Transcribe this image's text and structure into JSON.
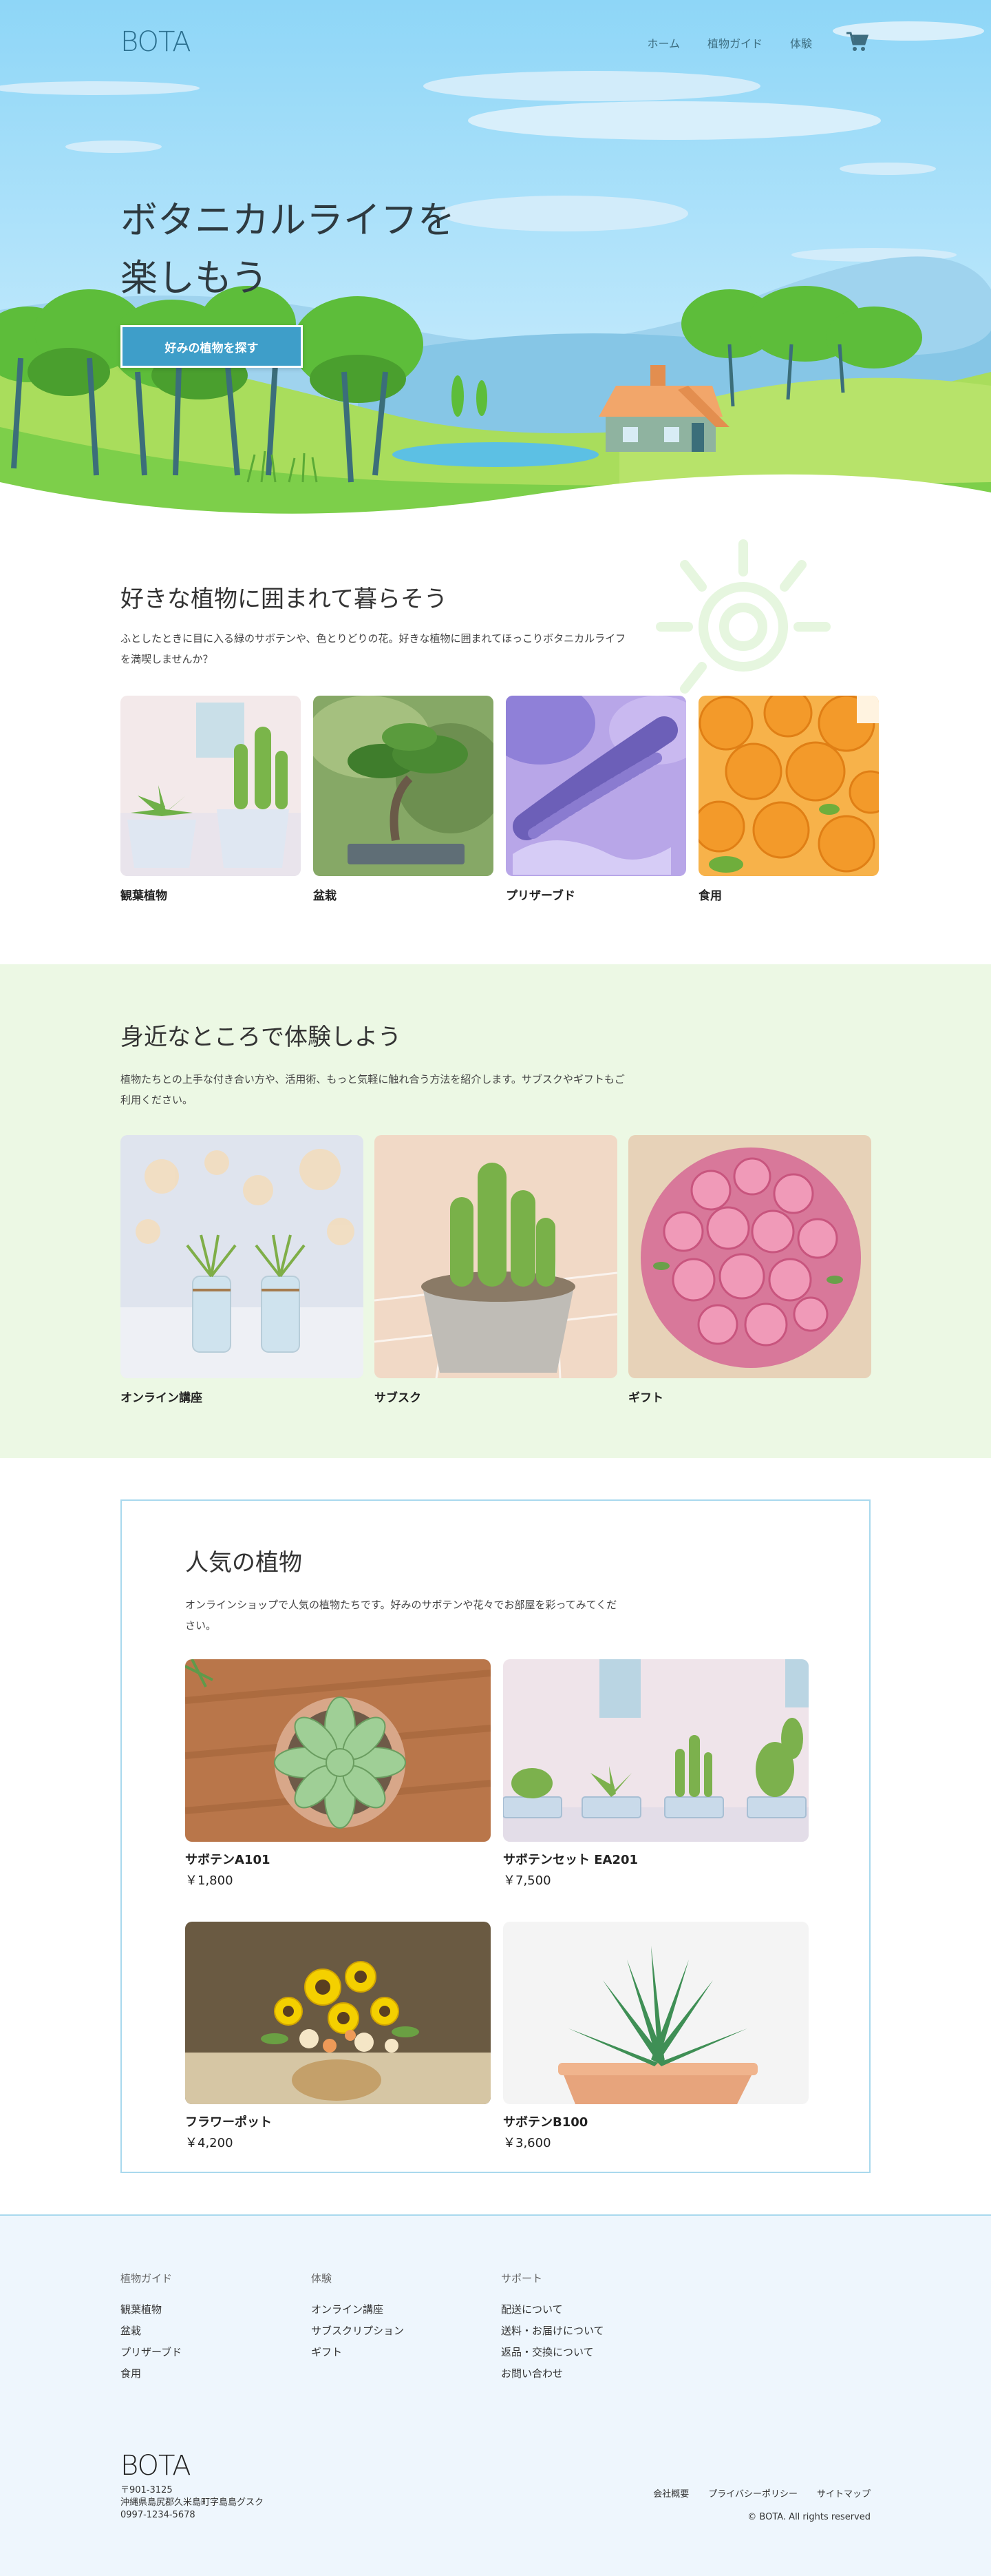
{
  "header": {
    "logo": "BOTA",
    "nav": [
      "ホーム",
      "植物ガイド",
      "体験"
    ],
    "cart_icon": "cart-icon"
  },
  "hero": {
    "title_line1": "ボタニカルライフを",
    "title_line2": "楽しもう",
    "cta": "好みの植物を探す"
  },
  "section_plants": {
    "title": "好きな植物に囲まれて暮らそう",
    "description": "ふとしたときに目に入る緑のサボテンや、色とりどりの花。好きな植物に囲まれてほっこりボタニカルライフを満喫しませんか？",
    "items": [
      {
        "label": "観葉植物"
      },
      {
        "label": "盆栽"
      },
      {
        "label": "プリザーブド"
      },
      {
        "label": "食用"
      }
    ]
  },
  "section_experience": {
    "title": "身近なところで体験しよう",
    "description": "植物たちとの上手な付き合い方や、活用術、もっと気軽に触れ合う方法を紹介します。サブスクやギフトもご利用ください。",
    "items": [
      {
        "label": "オンライン講座"
      },
      {
        "label": "サブスク"
      },
      {
        "label": "ギフト"
      }
    ]
  },
  "section_popular": {
    "title": "人気の植物",
    "description": "オンラインショップで人気の植物たちです。好みのサボテンや花々でお部屋を彩ってみてください。",
    "products": [
      {
        "name": "サボテンA101",
        "price": "￥1,800"
      },
      {
        "name": "サボテンセット EA201",
        "price": "￥7,500"
      },
      {
        "name": "フラワーポット",
        "price": "￥4,200"
      },
      {
        "name": "サボテンB100",
        "price": "￥3,600"
      }
    ]
  },
  "footer": {
    "columns": [
      {
        "heading": "植物ガイド",
        "links": [
          "観葉植物",
          "盆栽",
          "プリザーブド",
          "食用"
        ]
      },
      {
        "heading": "体験",
        "links": [
          "オンライン講座",
          "サブスクリプション",
          "ギフト"
        ]
      },
      {
        "heading": "サポート",
        "links": [
          "配送について",
          "送料・お届けについて",
          "返品・交換について",
          "お問い合わせ"
        ]
      }
    ],
    "logo": "BOTA",
    "address": [
      "〒901-3125",
      "沖縄県島尻郡久米島町字島島グスク",
      "0997-1234-5678"
    ],
    "bottom_links": [
      "会社概要",
      "プライバシーポリシー",
      "サイトマップ"
    ],
    "copyright": "© BOTA. All rights reserved"
  },
  "colors": {
    "accent": "#3e9ec9",
    "sky": "#8fd3f5",
    "grass": "#7dcf4a",
    "experience_bg": "#ecf8e4",
    "footer_bg": "#eef6fd"
  }
}
